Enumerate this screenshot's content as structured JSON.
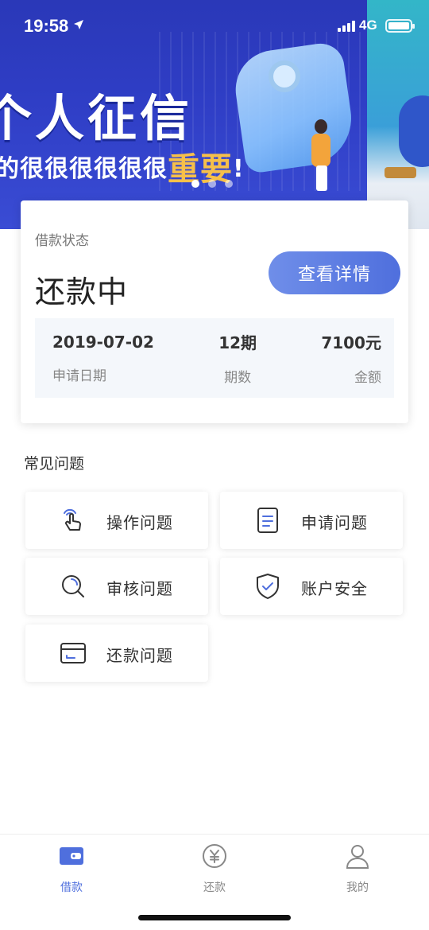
{
  "status_bar": {
    "time": "19:58",
    "network": "4G"
  },
  "banner": {
    "title": "个人征信",
    "subtitle_prefix": "的很很很很很很",
    "subtitle_emphasis": "重要",
    "subtitle_suffix": "!",
    "page_count": 3,
    "active_page": 1
  },
  "loan_status": {
    "label": "借款状态",
    "status": "还款中",
    "detail_button": "查看详情",
    "summary": [
      {
        "value": "2019-07-02",
        "label": "申请日期"
      },
      {
        "value": "12期",
        "label": "期数"
      },
      {
        "value": "7100元",
        "label": "金额"
      }
    ]
  },
  "faq": {
    "title": "常见问题",
    "items": [
      {
        "label": "操作问题",
        "icon": "tap-hand-icon"
      },
      {
        "label": "申请问题",
        "icon": "document-icon"
      },
      {
        "label": "审核问题",
        "icon": "search-icon"
      },
      {
        "label": "账户安全",
        "icon": "shield-check-icon"
      },
      {
        "label": "还款问题",
        "icon": "card-icon"
      }
    ]
  },
  "tabbar": {
    "tabs": [
      {
        "label": "借款",
        "icon": "wallet-icon",
        "active": true
      },
      {
        "label": "还款",
        "icon": "yen-circle-icon",
        "active": false
      },
      {
        "label": "我的",
        "icon": "user-icon",
        "active": false
      }
    ]
  },
  "colors": {
    "accent": "#4f6fdd",
    "banner": "#2f3ec6"
  }
}
